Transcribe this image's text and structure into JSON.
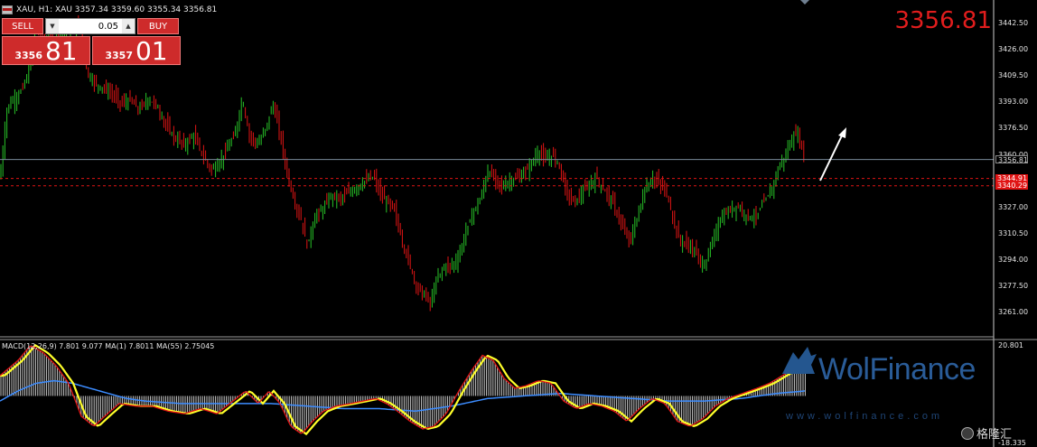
{
  "header": {
    "text": "XAU, H1:  XAU  3357.34 3359.60 3355.34 3356.81"
  },
  "trade_panel": {
    "sell_label": "SELL",
    "buy_label": "BUY",
    "lot_value": "0.05",
    "bid_small": "3356",
    "bid_big": "81",
    "ask_small": "3357",
    "ask_big": "01"
  },
  "big_price": "3356.81",
  "macd_label": "MACD(12,26,9) 7.801 9.077 MA(1) 7.8011 MA(55) 2.75045",
  "watermark": {
    "brand": "WolFinance",
    "url": "www.wolfinance.com"
  },
  "corner_brand": "格隆汇",
  "colors": {
    "bull": "#27c227",
    "bear": "#e01414",
    "macd_fast": "#e01414",
    "macd_slow": "#ffff2a",
    "macd_ma": "#3c8cff",
    "accent": "#e11d1d"
  },
  "chart_data": {
    "type": "candlestick",
    "title": "XAU, H1",
    "ohlc_last": {
      "open": 3357.34,
      "high": 3359.6,
      "low": 3355.34,
      "close": 3356.81
    },
    "ylim": [
      3246,
      3457
    ],
    "y_ticks": [
      "3442.50",
      "3426.00",
      "3409.50",
      "3393.00",
      "3376.50",
      "3360.00",
      "3327.00",
      "3310.50",
      "3294.00",
      "3277.50",
      "3261.00"
    ],
    "current_price_line": {
      "value": 3356.81,
      "label": "3356.81"
    },
    "horizontal_levels": [
      {
        "value": 3344.91,
        "label": "3344.91",
        "style": "dashed",
        "color": "#e01414"
      },
      {
        "value": 3340.29,
        "label": "3340.29",
        "style": "dashed",
        "color": "#e01414"
      }
    ],
    "price_path": [
      [
        0,
        3345
      ],
      [
        8,
        3390
      ],
      [
        16,
        3395
      ],
      [
        24,
        3400
      ],
      [
        32,
        3412
      ],
      [
        40,
        3442
      ],
      [
        50,
        3430
      ],
      [
        60,
        3432
      ],
      [
        70,
        3436
      ],
      [
        80,
        3438
      ],
      [
        88,
        3442
      ],
      [
        96,
        3412
      ],
      [
        104,
        3405
      ],
      [
        114,
        3402
      ],
      [
        124,
        3398
      ],
      [
        134,
        3392
      ],
      [
        144,
        3394
      ],
      [
        154,
        3388
      ],
      [
        164,
        3395
      ],
      [
        174,
        3390
      ],
      [
        184,
        3378
      ],
      [
        194,
        3370
      ],
      [
        204,
        3366
      ],
      [
        214,
        3372
      ],
      [
        224,
        3360
      ],
      [
        234,
        3350
      ],
      [
        244,
        3356
      ],
      [
        252,
        3364
      ],
      [
        260,
        3372
      ],
      [
        268,
        3395
      ],
      [
        276,
        3372
      ],
      [
        286,
        3366
      ],
      [
        294,
        3376
      ],
      [
        302,
        3392
      ],
      [
        310,
        3372
      ],
      [
        318,
        3348
      ],
      [
        326,
        3330
      ],
      [
        334,
        3318
      ],
      [
        340,
        3302
      ],
      [
        348,
        3320
      ],
      [
        358,
        3326
      ],
      [
        366,
        3334
      ],
      [
        376,
        3332
      ],
      [
        386,
        3336
      ],
      [
        396,
        3340
      ],
      [
        406,
        3344
      ],
      [
        414,
        3346
      ],
      [
        420,
        3336
      ],
      [
        428,
        3330
      ],
      [
        436,
        3326
      ],
      [
        446,
        3304
      ],
      [
        454,
        3290
      ],
      [
        462,
        3276
      ],
      [
        470,
        3272
      ],
      [
        476,
        3266
      ],
      [
        484,
        3282
      ],
      [
        492,
        3290
      ],
      [
        500,
        3290
      ],
      [
        508,
        3296
      ],
      [
        516,
        3312
      ],
      [
        524,
        3324
      ],
      [
        532,
        3332
      ],
      [
        540,
        3350
      ],
      [
        548,
        3344
      ],
      [
        556,
        3340
      ],
      [
        566,
        3344
      ],
      [
        576,
        3346
      ],
      [
        586,
        3352
      ],
      [
        596,
        3362
      ],
      [
        604,
        3356
      ],
      [
        612,
        3360
      ],
      [
        620,
        3352
      ],
      [
        626,
        3338
      ],
      [
        634,
        3330
      ],
      [
        642,
        3334
      ],
      [
        652,
        3340
      ],
      [
        660,
        3346
      ],
      [
        668,
        3338
      ],
      [
        676,
        3332
      ],
      [
        684,
        3322
      ],
      [
        692,
        3310
      ],
      [
        698,
        3306
      ],
      [
        706,
        3322
      ],
      [
        714,
        3338
      ],
      [
        722,
        3345
      ],
      [
        730,
        3342
      ],
      [
        738,
        3336
      ],
      [
        744,
        3322
      ],
      [
        752,
        3306
      ],
      [
        760,
        3304
      ],
      [
        768,
        3300
      ],
      [
        774,
        3294
      ],
      [
        780,
        3290
      ],
      [
        788,
        3304
      ],
      [
        796,
        3318
      ],
      [
        806,
        3324
      ],
      [
        816,
        3328
      ],
      [
        826,
        3322
      ],
      [
        836,
        3320
      ],
      [
        846,
        3330
      ],
      [
        854,
        3338
      ],
      [
        862,
        3352
      ],
      [
        870,
        3360
      ],
      [
        878,
        3372
      ],
      [
        884,
        3372
      ],
      [
        892,
        3356
      ]
    ],
    "macd_ylim": [
      -18.335,
      20.801
    ],
    "macd_y_ticks": [
      "20.801",
      "-18.335"
    ],
    "macd_path": [
      [
        0,
        8
      ],
      [
        20,
        14
      ],
      [
        34,
        20
      ],
      [
        48,
        17
      ],
      [
        62,
        12
      ],
      [
        76,
        5
      ],
      [
        90,
        -8
      ],
      [
        104,
        -12
      ],
      [
        116,
        -8
      ],
      [
        132,
        -3
      ],
      [
        150,
        -4
      ],
      [
        168,
        -4
      ],
      [
        186,
        -6
      ],
      [
        204,
        -7
      ],
      [
        222,
        -5
      ],
      [
        240,
        -7
      ],
      [
        258,
        -2
      ],
      [
        272,
        2
      ],
      [
        286,
        -3
      ],
      [
        298,
        2
      ],
      [
        310,
        -3
      ],
      [
        322,
        -12
      ],
      [
        334,
        -15
      ],
      [
        346,
        -10
      ],
      [
        358,
        -6
      ],
      [
        372,
        -4
      ],
      [
        388,
        -3
      ],
      [
        402,
        -2
      ],
      [
        416,
        -1
      ],
      [
        428,
        -3
      ],
      [
        440,
        -6
      ],
      [
        454,
        -10
      ],
      [
        468,
        -13
      ],
      [
        480,
        -12
      ],
      [
        494,
        -7
      ],
      [
        508,
        2
      ],
      [
        522,
        10
      ],
      [
        534,
        16
      ],
      [
        546,
        14
      ],
      [
        558,
        7
      ],
      [
        570,
        3
      ],
      [
        582,
        4
      ],
      [
        596,
        6
      ],
      [
        610,
        5
      ],
      [
        624,
        -2
      ],
      [
        638,
        -5
      ],
      [
        652,
        -3
      ],
      [
        666,
        -4
      ],
      [
        680,
        -6
      ],
      [
        694,
        -10
      ],
      [
        708,
        -5
      ],
      [
        722,
        -1
      ],
      [
        736,
        -3
      ],
      [
        750,
        -10
      ],
      [
        764,
        -12
      ],
      [
        778,
        -9
      ],
      [
        792,
        -4
      ],
      [
        806,
        -1
      ],
      [
        822,
        1
      ],
      [
        838,
        3
      ],
      [
        852,
        5
      ],
      [
        866,
        8
      ],
      [
        880,
        11
      ],
      [
        892,
        9
      ]
    ],
    "macd_ma_path": [
      [
        0,
        -2
      ],
      [
        20,
        2
      ],
      [
        40,
        5
      ],
      [
        60,
        6
      ],
      [
        80,
        5
      ],
      [
        100,
        3
      ],
      [
        120,
        1
      ],
      [
        140,
        -1
      ],
      [
        160,
        -2
      ],
      [
        200,
        -3
      ],
      [
        250,
        -3
      ],
      [
        300,
        -3
      ],
      [
        340,
        -4
      ],
      [
        380,
        -5
      ],
      [
        420,
        -5
      ],
      [
        460,
        -6
      ],
      [
        500,
        -4
      ],
      [
        540,
        -1
      ],
      [
        580,
        0
      ],
      [
        620,
        1
      ],
      [
        660,
        0
      ],
      [
        700,
        -1
      ],
      [
        740,
        -2
      ],
      [
        780,
        -2
      ],
      [
        820,
        -1
      ],
      [
        860,
        1
      ],
      [
        892,
        2
      ]
    ]
  }
}
